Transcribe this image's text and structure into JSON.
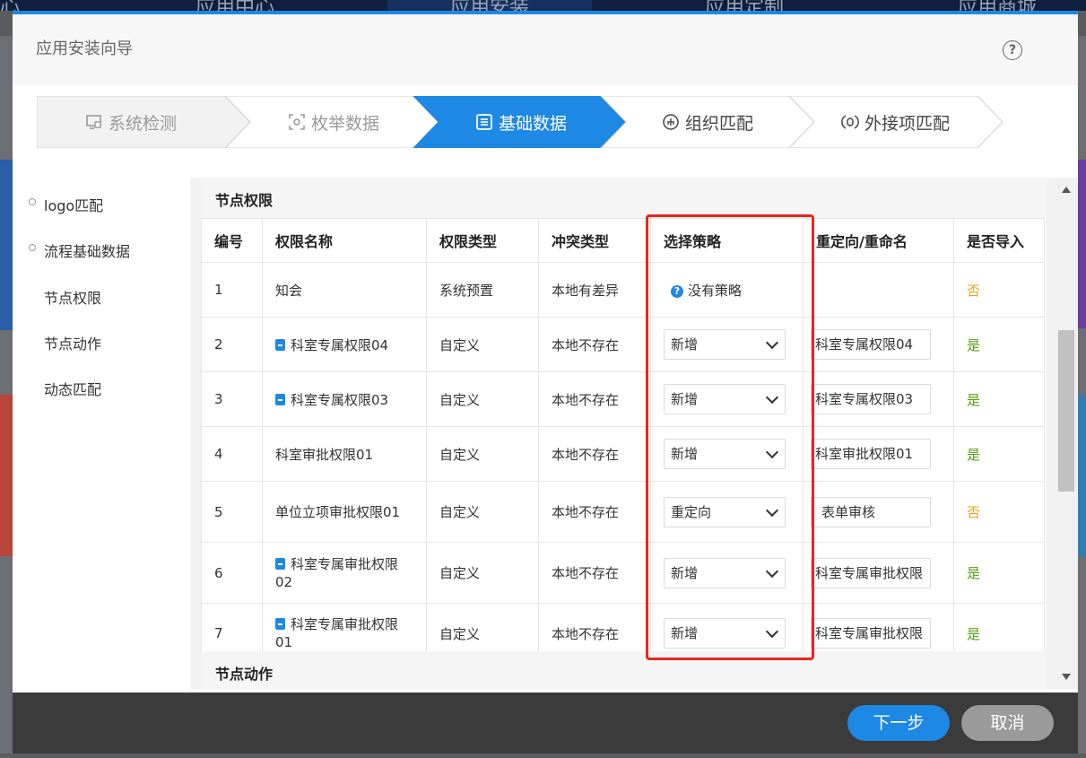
{
  "background": {
    "tabs": [
      "心",
      "应用中心",
      "应用安装",
      "应用定制",
      "应用商城"
    ]
  },
  "modal": {
    "title": "应用安装向导",
    "help_icon": "?"
  },
  "steps": [
    {
      "label": "系统检测",
      "state": "done",
      "icon": "monitor-icon"
    },
    {
      "label": "枚举数据",
      "state": "done",
      "icon": "scan-icon"
    },
    {
      "label": "基础数据",
      "state": "active",
      "icon": "list-icon"
    },
    {
      "label": "组织匹配",
      "state": "todo",
      "icon": "org-icon"
    },
    {
      "label": "外接项匹配",
      "state": "todo",
      "icon": "link-icon"
    }
  ],
  "nav": {
    "items": [
      "logo匹配",
      "流程基础数据",
      "节点权限",
      "节点动作",
      "动态匹配"
    ]
  },
  "section": {
    "title": "节点权限",
    "next_title": "节点动作"
  },
  "table": {
    "headers": [
      "编号",
      "权限名称",
      "权限类型",
      "冲突类型",
      "选择策略",
      "重定向/重命名",
      "是否导入"
    ],
    "rows": [
      {
        "no": "1",
        "name": "知会",
        "type": "系统预置",
        "conflict": "本地有差异",
        "strategy": "没有策略",
        "rename": "",
        "import": "否"
      },
      {
        "no": "2",
        "name": "科室专属权限04",
        "type": "自定义",
        "conflict": "本地不存在",
        "strategy": "新增",
        "rename": "科室专属权限04",
        "import": "是"
      },
      {
        "no": "3",
        "name": "科室专属权限03",
        "type": "自定义",
        "conflict": "本地不存在",
        "strategy": "新增",
        "rename": "科室专属权限03",
        "import": "是"
      },
      {
        "no": "4",
        "name": "科室审批权限01",
        "type": "自定义",
        "conflict": "本地不存在",
        "strategy": "新增",
        "rename": "科室审批权限01",
        "import": "是"
      },
      {
        "no": "5",
        "name": "单位立项审批权限01",
        "type": "自定义",
        "conflict": "本地不存在",
        "strategy": "重定向",
        "rename": "表单审核",
        "import": "否"
      },
      {
        "no": "6",
        "name": "科室专属审批权限02",
        "type": "自定义",
        "conflict": "本地不存在",
        "strategy": "新增",
        "rename": "科室专属审批权限",
        "import": "是"
      },
      {
        "no": "7",
        "name": "科室专属审批权限01",
        "type": "自定义",
        "conflict": "本地不存在",
        "strategy": "新增",
        "rename": "科室专属审批权限",
        "import": "是"
      }
    ]
  },
  "footer": {
    "next_label": "下一步",
    "cancel_label": "取消"
  },
  "colors": {
    "accent": "#1e88e5",
    "highlight": "#f0231c",
    "yes": "#52a012",
    "no": "#f0a020"
  }
}
